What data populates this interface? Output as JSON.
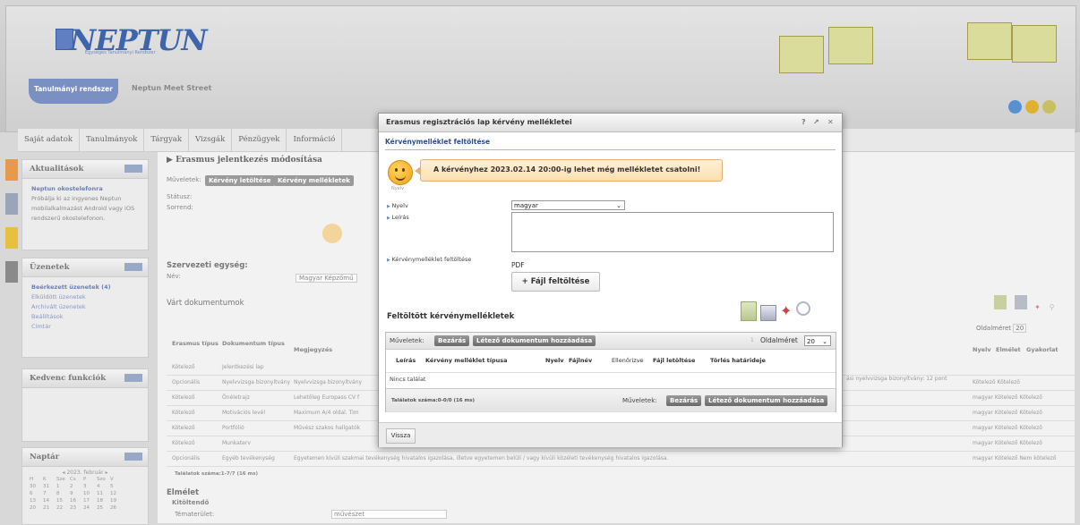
{
  "header": {
    "logo_text": "NEPTUN",
    "logo_subtitle": "Egységes Tanulmányi Rendszer",
    "system_tab": "Tanulmányi rendszer",
    "street": "Neptun Meet Street"
  },
  "menu": [
    "Saját adatok",
    "Tanulmányok",
    "Tárgyak",
    "Vizsgák",
    "Pénzügyek",
    "Információ"
  ],
  "sidebar": {
    "news": {
      "title": "Aktualitások",
      "headline": "Neptun okostelefonra",
      "body": "Próbálja ki az ingyenes Neptun mobilalkalmazást Android vagy iOS rendszerű okostelefonon."
    },
    "messages": {
      "title": "Üzenetek",
      "items": [
        "Beérkezett üzenetek (4)",
        "Elküldött üzenetek",
        "Archivált üzenetek",
        "Beállítások",
        "Címtár"
      ]
    },
    "favorites": {
      "title": "Kedvenc funkciók"
    },
    "calendar": {
      "title": "Naptár",
      "month": "2023. február",
      "weekdays": [
        "H",
        "K",
        "Sze",
        "Cs",
        "P",
        "Szo",
        "V"
      ],
      "rows": [
        [
          "30",
          "31",
          "1",
          "2",
          "3",
          "4",
          "5"
        ],
        [
          "6",
          "7",
          "8",
          "9",
          "10",
          "11",
          "12"
        ],
        [
          "13",
          "14",
          "15",
          "16",
          "17",
          "18",
          "19"
        ],
        [
          "20",
          "21",
          "22",
          "23",
          "24",
          "25",
          "26"
        ]
      ]
    }
  },
  "main": {
    "title": "Erasmus jelentkezés módosítása",
    "ops_label": "Műveletek:",
    "btn1": "Kérvény letöltése",
    "btn2": "Kérvény mellékletek",
    "status_label": "Státusz:",
    "order_label": "Sorrend:",
    "org_unit": "Szervezeti egység:",
    "name_label": "Név:",
    "name_value": "Magyar Képzőmű",
    "expected_docs": "Várt dokumentumok",
    "page_size_label": "Oldalméret",
    "page_size_value": "20",
    "col_type": "Erasmus típus",
    "col_doc": "Dokumentum típus",
    "col_note": "Megjegyzés",
    "col_lang": "Nyelv",
    "col_required": "Elmélet",
    "col_practice": "Gyakorlat",
    "rows": [
      {
        "type": "Kötelező",
        "doc": "Jelentkezési lap",
        "note": "",
        "right": ""
      },
      {
        "type": "Opcionális",
        "doc": "Nyelvvizsga bizonyítvány",
        "note": "Nyelvvizsga bizonyítvány",
        "right": "Kötelező Kötelező"
      },
      {
        "type": "Kötelező",
        "doc": "Önéletrajz",
        "note": "Lehetőleg Europass CV f",
        "right": "magyar Kötelező Kötelező"
      },
      {
        "type": "Kötelező",
        "doc": "Motivációs levél",
        "note": "Maximum A/4 oldal. Tim",
        "right": "magyar Kötelező Kötelező"
      },
      {
        "type": "Kötelező",
        "doc": "Portfólió",
        "note": "Művész szakos hallgatók",
        "right": "magyar Kötelező Kötelező"
      },
      {
        "type": "Kötelező",
        "doc": "Munkaterv",
        "note": "",
        "right": "magyar Kötelező Kötelező"
      },
      {
        "type": "Opcionális",
        "doc": "Egyéb tevékenység",
        "note": "Egyetemen kívüli szakmai tevékenység hivatalos igazolása, illetve egyetemen belüli / vagy kívüli közéleti tevékenység hivatalos igazolása.",
        "right": "magyar Kötelező Nem kötelező"
      }
    ],
    "right_extra": "ási nyelvvizsga bizonyítvány: 12 pont",
    "hits": "Találatok száma:1-7/7 (16 ms)",
    "elmelet": "Elmélet",
    "kitoltendo": "Kitöltendő",
    "topic_label": "Tématerület:",
    "topic_value": "művészet"
  },
  "modal": {
    "title": "Erasmus regisztrációs lap kérvény mellékletei",
    "controls": [
      "?",
      "↗",
      "✕"
    ],
    "subtab": "Kérvénymelléklet feltöltése",
    "notice": "A kérvényhez 2023.02.14 20:00-ig lehet még mellékletet csatolni!",
    "smiley_caption": "Nyelv",
    "lang_label": "Nyelv",
    "lang_value": "magyar",
    "desc_label": "Leírás",
    "upload_label": "Kérvénymelléklet feltöltése",
    "format": "PDF",
    "upload_button": "+ Fájl feltöltése",
    "uploaded_title": "Feltöltött kérvénymellékletek",
    "ops_label": "Műveletek:",
    "close_button": "Bezárás",
    "add_existing_button": "Létező dokumentum hozzáadása",
    "pager_num": "1",
    "page_size_label": "Oldalméret",
    "page_size_value": "20",
    "columns": [
      "Leírás",
      "Kérvény melléklet típusa",
      "Nyelv",
      "Fájlnév",
      "Ellenőrizve",
      "Fájl letöltése",
      "Törlés határideje"
    ],
    "no_results": "Nincs találat",
    "hits": "Találatok száma:0-0/0 (16 ms)",
    "back_button": "Vissza"
  }
}
